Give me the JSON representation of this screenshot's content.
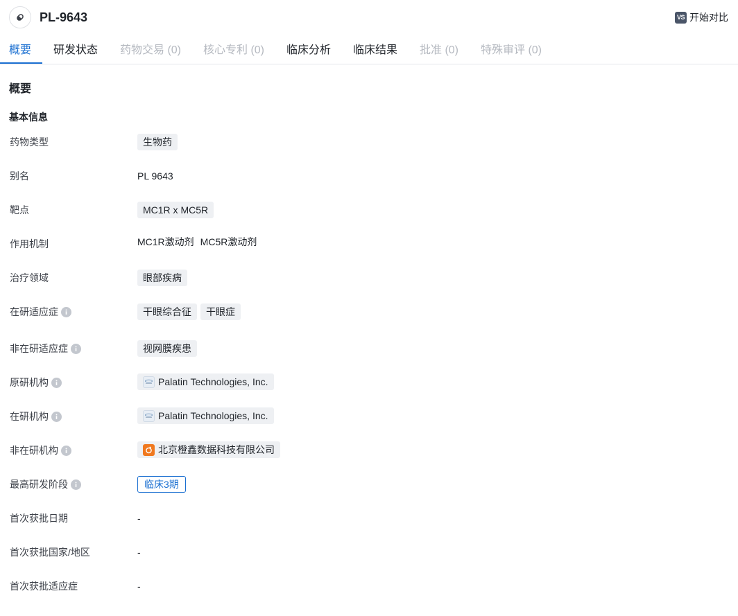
{
  "header": {
    "title": "PL-9643",
    "compare_badge": "VS",
    "compare_label": "开始对比"
  },
  "tabs": [
    {
      "label": "概要",
      "state": "active"
    },
    {
      "label": "研发状态",
      "state": "normal"
    },
    {
      "label": "药物交易 (0)",
      "state": "disabled"
    },
    {
      "label": "核心专利 (0)",
      "state": "disabled"
    },
    {
      "label": "临床分析",
      "state": "normal"
    },
    {
      "label": "临床结果",
      "state": "normal"
    },
    {
      "label": "批准 (0)",
      "state": "disabled"
    },
    {
      "label": "特殊审评 (0)",
      "state": "disabled"
    }
  ],
  "section_title": "概要",
  "basic_info": {
    "title": "基本信息",
    "drug_type": {
      "label": "药物类型",
      "tags": [
        "生物药"
      ]
    },
    "alias": {
      "label": "别名",
      "value": "PL 9643"
    },
    "target": {
      "label": "靶点",
      "tags": [
        "MC1R x MC5R"
      ]
    },
    "mechanism": {
      "label": "作用机制",
      "values": [
        "MC1R激动剂",
        "MC5R激动剂"
      ]
    },
    "therapeutic_area": {
      "label": "治疗领域",
      "tags": [
        "眼部疾病"
      ]
    },
    "active_indication": {
      "label": "在研适应症",
      "tags": [
        "干眼综合征",
        "干眼症"
      ]
    },
    "inactive_indication": {
      "label": "非在研适应症",
      "tags": [
        "视网膜疾患"
      ]
    },
    "originator": {
      "label": "原研机构",
      "org": "Palatin Technologies, Inc."
    },
    "active_org": {
      "label": "在研机构",
      "org": "Palatin Technologies, Inc."
    },
    "inactive_org": {
      "label": "非在研机构",
      "org": "北京橙鑫数据科技有限公司"
    },
    "highest_phase": {
      "label": "最高研发阶段",
      "value": "临床3期"
    },
    "first_approval_date": {
      "label": "首次获批日期",
      "value": "-"
    },
    "first_approval_region": {
      "label": "首次获批国家/地区",
      "value": "-"
    },
    "first_approval_indication": {
      "label": "首次获批适应症",
      "value": "-"
    }
  },
  "colors": {
    "accent": "#1a6fd1",
    "disabled_tab": "#b5b9c0",
    "tag_bg": "#eef0f3"
  }
}
